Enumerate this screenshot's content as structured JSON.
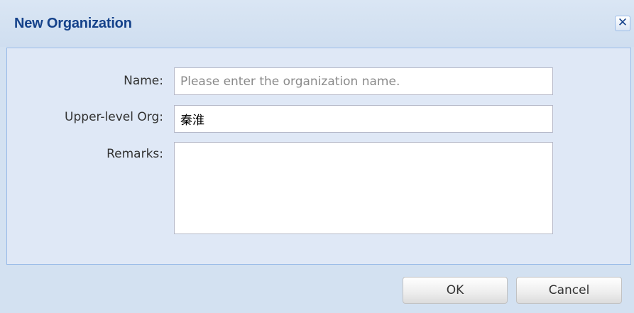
{
  "dialog": {
    "title": "New Organization",
    "close_icon": "close-icon",
    "close_glyph": "✕"
  },
  "form": {
    "name": {
      "label": "Name:",
      "value": "",
      "placeholder": "Please enter the organization name."
    },
    "upper_org": {
      "label": "Upper-level Org:",
      "value": "秦淮"
    },
    "remarks": {
      "label": "Remarks:",
      "value": ""
    }
  },
  "buttons": {
    "ok_label": "OK",
    "cancel_label": "Cancel"
  },
  "colors": {
    "title_text": "#15428b",
    "window_bg": "#d3e1f1",
    "panel_bg": "#dfe8f6",
    "panel_border": "#99bbe8"
  }
}
